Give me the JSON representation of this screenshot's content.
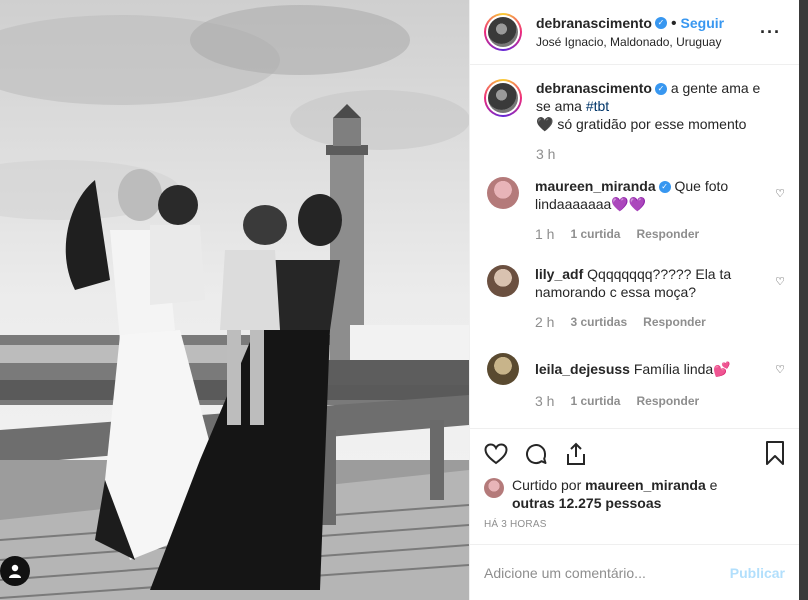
{
  "post": {
    "username": "debranascimento",
    "follow_label": "Seguir",
    "location": "José Ignacio, Maldonado, Uruguay",
    "more_icon": "more-options-icon"
  },
  "caption": {
    "username": "debranascimento",
    "text_before_tag": "a gente ama e se ama ",
    "tag": "#tbt",
    "line2": "🖤 só gratidão por esse momento",
    "time": "3 h"
  },
  "comments": [
    {
      "username": "maureen_miranda",
      "verified": true,
      "text": "Que foto lindaaaaaaa💜💜",
      "time": "1 h",
      "likes": "1 curtida",
      "reply": "Responder"
    },
    {
      "username": "lily_adf",
      "verified": false,
      "text": "Qqqqqqqq????? Ela ta namorando c essa moça?",
      "time": "2 h",
      "likes": "3 curtidas",
      "reply": "Responder"
    },
    {
      "username": "leila_dejesuss",
      "verified": false,
      "text": "Família linda💕",
      "time": "3 h",
      "likes": "1 curtida",
      "reply": "Responder"
    }
  ],
  "likes_line": {
    "prefix": "Curtido por ",
    "user": "maureen_miranda",
    "middle": " e",
    "others": "outras 12.275 pessoas"
  },
  "posted_ago": "HÁ 3 HORAS",
  "add_comment": {
    "placeholder": "Adicione um comentário...",
    "publish_label": "Publicar"
  },
  "colors": {
    "accent": "#3897f0",
    "muted": "#8e8e8e",
    "publish_disabled": "#b2dffc"
  }
}
